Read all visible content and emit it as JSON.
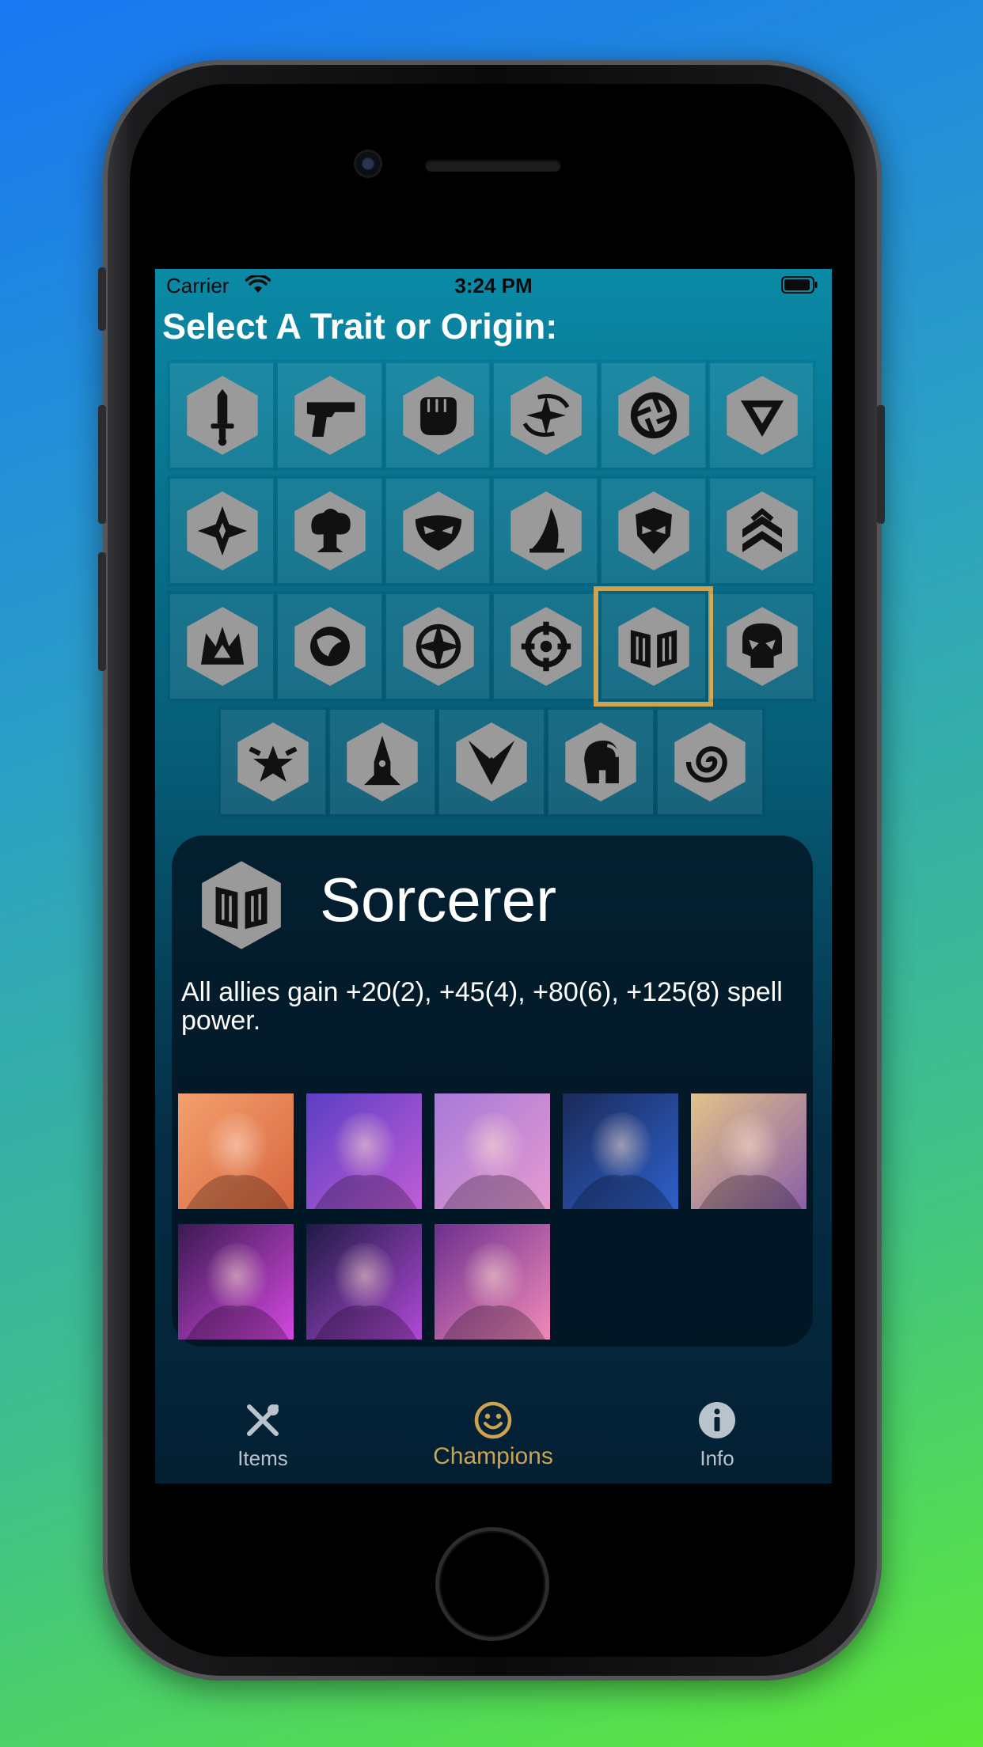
{
  "status_bar": {
    "carrier": "Carrier",
    "time": "3:24 PM"
  },
  "heading": "Select A Trait or Origin:",
  "colors": {
    "accent_gold": "#cda351",
    "hex_fill": "#9a9a9a",
    "glyph": "#111111",
    "tab_inactive": "#b8c3cb"
  },
  "traits": [
    {
      "icon": "sword-icon"
    },
    {
      "icon": "gun-icon"
    },
    {
      "icon": "fist-icon"
    },
    {
      "icon": "sparkle-icon"
    },
    {
      "icon": "aperture-icon"
    },
    {
      "icon": "triangle-icon"
    },
    {
      "icon": "star-spark-icon"
    },
    {
      "icon": "mushroom-cloud-icon"
    },
    {
      "icon": "mask-icon"
    },
    {
      "icon": "blade-icon"
    },
    {
      "icon": "helmet-icon"
    },
    {
      "icon": "chevrons-up-icon"
    },
    {
      "icon": "crown-icon"
    },
    {
      "icon": "swirl-orb-icon"
    },
    {
      "icon": "compass-star-icon"
    },
    {
      "icon": "crosshair-icon"
    },
    {
      "icon": "book-icon",
      "selected": true
    },
    {
      "icon": "skull-icon"
    },
    {
      "icon": "star-guardian-icon"
    },
    {
      "icon": "rocket-icon"
    },
    {
      "icon": "wings-icon"
    },
    {
      "icon": "spartan-helmet-icon"
    },
    {
      "icon": "spiral-icon"
    }
  ],
  "detail": {
    "name": "Sorcerer",
    "icon": "book-icon",
    "description": "All allies gain +20(2), +45(4), +80(6), +125(8) spell power.",
    "champions": [
      {
        "icon": "champion-portrait-1",
        "colors": [
          "#f3a06e",
          "#d8663f"
        ]
      },
      {
        "icon": "champion-portrait-2",
        "colors": [
          "#5b3fc4",
          "#c05cd6"
        ]
      },
      {
        "icon": "champion-portrait-3",
        "colors": [
          "#a77ad9",
          "#e59ad0"
        ]
      },
      {
        "icon": "champion-portrait-4",
        "colors": [
          "#1a2a5a",
          "#2e60c9"
        ]
      },
      {
        "icon": "champion-portrait-5",
        "colors": [
          "#e2c28a",
          "#8a5fa7"
        ]
      },
      {
        "icon": "champion-portrait-6",
        "colors": [
          "#3b1a52",
          "#d448e0"
        ]
      },
      {
        "icon": "champion-portrait-7",
        "colors": [
          "#1f1a45",
          "#b04ad6"
        ]
      },
      {
        "icon": "champion-portrait-8",
        "colors": [
          "#6d2f8f",
          "#f08ab8"
        ]
      }
    ]
  },
  "tabs": [
    {
      "label": "Items",
      "icon": "sword-fork-icon",
      "active": false
    },
    {
      "label": "Champions",
      "icon": "smiley-icon",
      "active": true
    },
    {
      "label": "Info",
      "icon": "info-icon",
      "active": false
    }
  ]
}
